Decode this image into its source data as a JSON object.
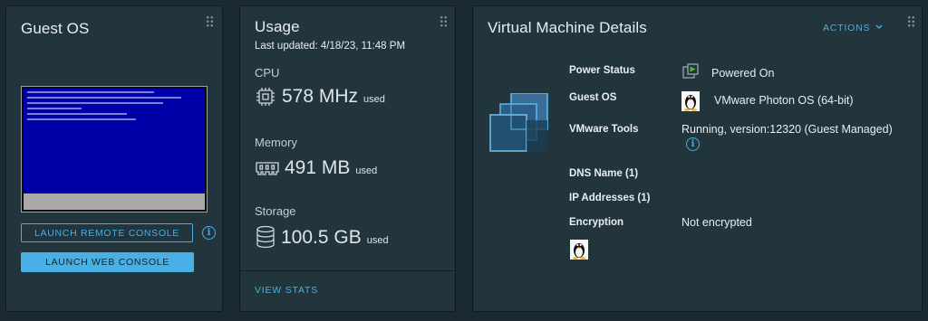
{
  "guest_os": {
    "title": "Guest OS",
    "launch_remote_label": "LAUNCH REMOTE CONSOLE",
    "launch_web_label": "LAUNCH WEB CONSOLE"
  },
  "usage": {
    "title": "Usage",
    "last_updated": "Last updated: 4/18/23, 11:48 PM",
    "cpu": {
      "label": "CPU",
      "value": "578 MHz",
      "unit": "used"
    },
    "memory": {
      "label": "Memory",
      "value": "491 MB",
      "unit": "used"
    },
    "storage": {
      "label": "Storage",
      "value": "100.5 GB",
      "unit": "used"
    },
    "view_stats_label": "VIEW STATS"
  },
  "vm_details": {
    "title": "Virtual Machine Details",
    "actions_label": "ACTIONS",
    "fields": {
      "power_status": {
        "label": "Power Status",
        "value": "Powered On"
      },
      "guest_os": {
        "label": "Guest OS",
        "value": "VMware Photon OS (64-bit)"
      },
      "vmware_tools": {
        "label": "VMware Tools",
        "value": "Running, version:12320 (Guest Managed)"
      },
      "dns_name": {
        "label": "DNS Name (1)"
      },
      "ip_addresses": {
        "label": "IP Addresses (1)"
      },
      "encryption": {
        "label": "Encryption",
        "value": "Not encrypted"
      }
    }
  },
  "colors": {
    "accent": "#49b0e6",
    "card_bg": "#22343c",
    "page_bg": "#1b2a32",
    "powered_on": "#61b030"
  },
  "icons": [
    "grip-icon",
    "info-icon",
    "cpu-icon",
    "memory-icon",
    "storage-icon",
    "vm-stack-icon",
    "power-on-icon",
    "linux-tux-icon",
    "chevron-down-icon"
  ]
}
